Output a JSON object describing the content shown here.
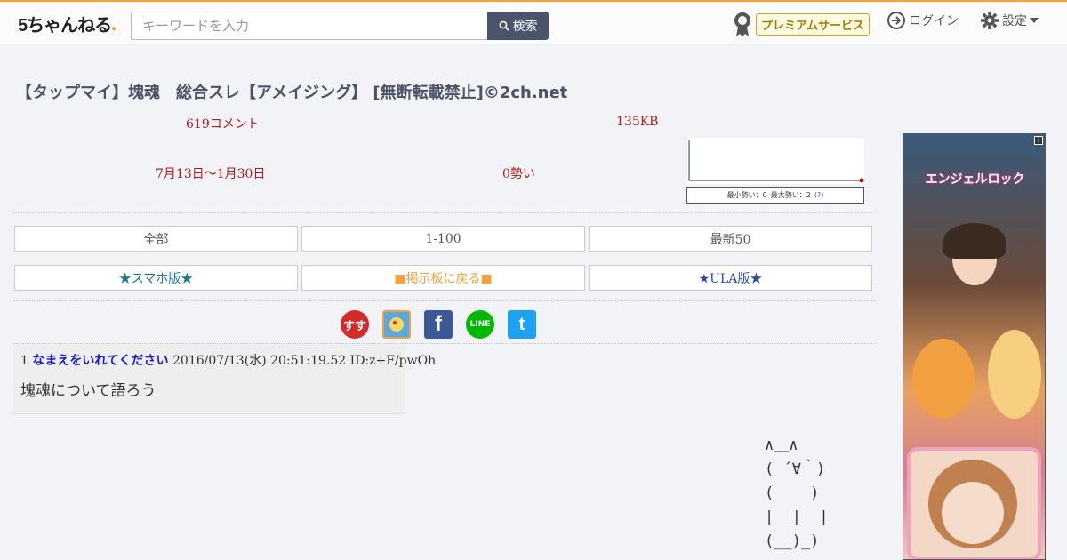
{
  "header": {
    "logo_text": "5ちゃんねる",
    "search_placeholder": "キーワードを入力",
    "search_button": "検索",
    "premium": "プレミアムサービス",
    "login": "ログイン",
    "settings": "設定"
  },
  "thread": {
    "title": "【タップマイ】塊魂　総合スレ【アメイジング】 [無断転載禁止]©2ch.net",
    "comments": "619コメント",
    "size": "135KB",
    "date_range": "7月13日〜1月30日",
    "momentum": "0勢い",
    "chart_caption_min": "最小勢い：0",
    "chart_caption_max": "最大勢い：2",
    "chart_caption_help": "(?)"
  },
  "nav": {
    "all": "全部",
    "range": "1-100",
    "latest": "最新50",
    "smartphone": "★スマホ版★",
    "back_to_board": "■掲示板に戻る■",
    "ula": "★ULA版★"
  },
  "share": {
    "susu_label": "すす",
    "facebook_label": "f",
    "line_label": "LINE",
    "twitter_label": "t"
  },
  "post": {
    "number": "1",
    "name": "なまえをいれてください",
    "datetime": "2016/07/13(水) 20:51:19.52",
    "id": "ID:z+F/pwOh",
    "body": "塊魂について語ろう"
  },
  "ascii_art": "∧＿∧\n( ´∀｀)\n(    )\n|  |  |\n(__)_)",
  "ad": {
    "info": "i",
    "logo": "エンジェルロック"
  },
  "colors": {
    "accent": "#f1a23a",
    "meta_red": "#b01c1c",
    "name_blue": "#1a1acc"
  }
}
